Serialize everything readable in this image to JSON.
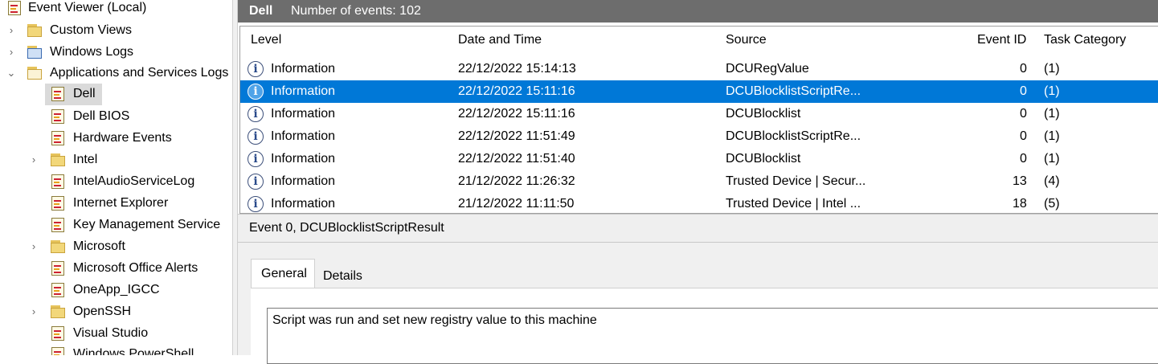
{
  "tree": {
    "root": "Event Viewer (Local)",
    "items": [
      {
        "label": "Custom Views"
      },
      {
        "label": "Windows Logs"
      },
      {
        "label": "Applications and Services Logs"
      },
      {
        "label": "Dell"
      },
      {
        "label": "Dell BIOS"
      },
      {
        "label": "Hardware Events"
      },
      {
        "label": "Intel"
      },
      {
        "label": "IntelAudioServiceLog"
      },
      {
        "label": "Internet Explorer"
      },
      {
        "label": "Key Management Service"
      },
      {
        "label": "Microsoft"
      },
      {
        "label": "Microsoft Office Alerts"
      },
      {
        "label": "OneApp_IGCC"
      },
      {
        "label": "OpenSSH"
      },
      {
        "label": "Visual Studio"
      },
      {
        "label": "Windows PowerShell"
      }
    ],
    "expander_collapsed": "›",
    "expander_expanded": "⌄"
  },
  "header": {
    "log_name": "Dell",
    "count_text": "Number of events: 102"
  },
  "grid": {
    "columns": [
      "Level",
      "Date and Time",
      "Source",
      "Event ID",
      "Task Category"
    ],
    "rows": [
      {
        "level": "Information",
        "datetime": "22/12/2022 15:14:13",
        "source": "DCURegValue",
        "event_id": "0",
        "task": "(1)"
      },
      {
        "level": "Information",
        "datetime": "22/12/2022 15:11:16",
        "source": "DCUBlocklistScriptRe...",
        "event_id": "0",
        "task": "(1)"
      },
      {
        "level": "Information",
        "datetime": "22/12/2022 15:11:16",
        "source": "DCUBlocklist",
        "event_id": "0",
        "task": "(1)"
      },
      {
        "level": "Information",
        "datetime": "22/12/2022 11:51:49",
        "source": "DCUBlocklistScriptRe...",
        "event_id": "0",
        "task": "(1)"
      },
      {
        "level": "Information",
        "datetime": "22/12/2022 11:51:40",
        "source": "DCUBlocklist",
        "event_id": "0",
        "task": "(1)"
      },
      {
        "level": "Information",
        "datetime": "21/12/2022 11:26:32",
        "source": "Trusted Device | Secur...",
        "event_id": "13",
        "task": "(4)"
      },
      {
        "level": "Information",
        "datetime": "21/12/2022 11:11:50",
        "source": "Trusted Device | Intel ...",
        "event_id": "18",
        "task": "(5)"
      }
    ],
    "info_glyph": "i"
  },
  "detail": {
    "title": "Event 0, DCUBlocklistScriptResult",
    "tabs": [
      "General",
      "Details"
    ],
    "description": "Script was run and set new registry value to this machine"
  },
  "colors": {
    "selection": "#0078d7",
    "header_bg": "#6d6d6d"
  }
}
